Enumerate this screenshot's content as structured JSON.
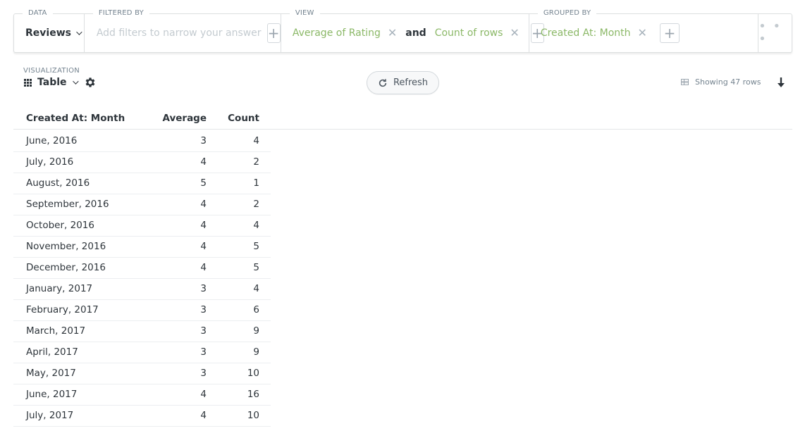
{
  "query_builder": {
    "data": {
      "label": "DATA",
      "value": "Reviews"
    },
    "filter": {
      "label": "FILTERED BY",
      "placeholder": "Add filters to narrow your answer"
    },
    "view": {
      "label": "VIEW",
      "metrics": [
        "Average of Rating",
        "Count of rows"
      ],
      "joiner": "and"
    },
    "group": {
      "label": "GROUPED BY",
      "breakouts": [
        "Created At: Month"
      ]
    },
    "more": "• • •"
  },
  "visualization": {
    "label": "VISUALIZATION",
    "type": "Table"
  },
  "refresh_label": "Refresh",
  "rows_info": "Showing 47 rows",
  "colors": {
    "accent_green": "#8bb867",
    "text": "#2e353b",
    "muted": "#74838f"
  },
  "table": {
    "columns": [
      "Created At: Month",
      "Average",
      "Count"
    ],
    "rows": [
      [
        "June, 2016",
        "3",
        "4"
      ],
      [
        "July, 2016",
        "4",
        "2"
      ],
      [
        "August, 2016",
        "5",
        "1"
      ],
      [
        "September, 2016",
        "4",
        "2"
      ],
      [
        "October, 2016",
        "4",
        "4"
      ],
      [
        "November, 2016",
        "4",
        "5"
      ],
      [
        "December, 2016",
        "4",
        "5"
      ],
      [
        "January, 2017",
        "3",
        "4"
      ],
      [
        "February, 2017",
        "3",
        "6"
      ],
      [
        "March, 2017",
        "3",
        "9"
      ],
      [
        "April, 2017",
        "3",
        "9"
      ],
      [
        "May, 2017",
        "3",
        "10"
      ],
      [
        "June, 2017",
        "4",
        "16"
      ],
      [
        "July, 2017",
        "4",
        "10"
      ]
    ]
  }
}
